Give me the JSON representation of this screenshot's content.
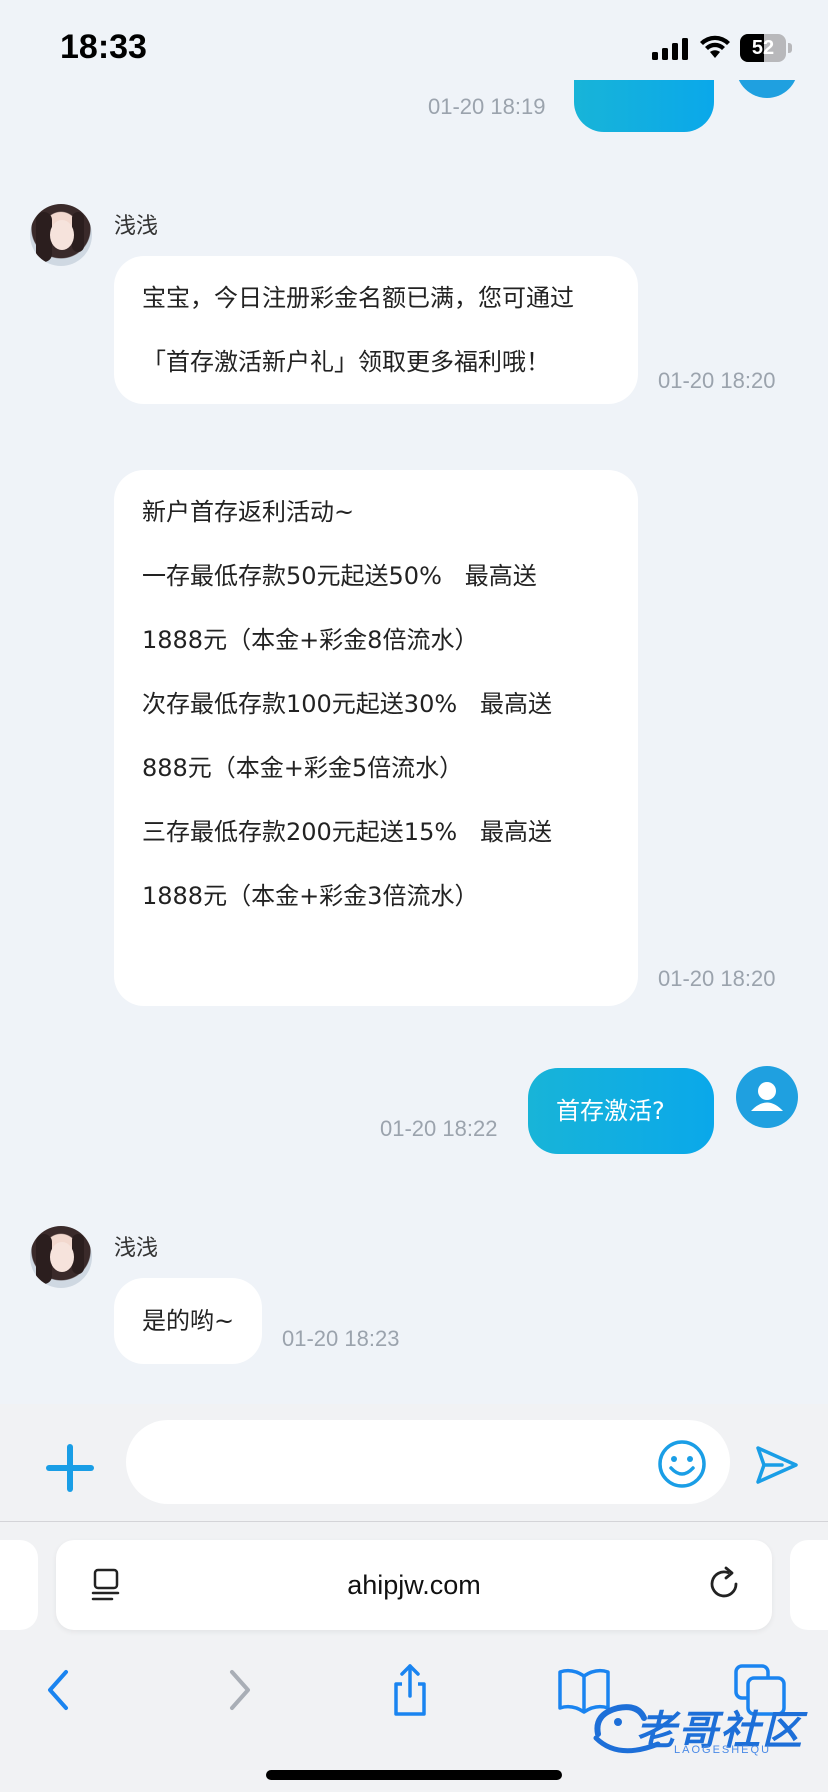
{
  "status_bar": {
    "time": "18:33",
    "battery_level": "52",
    "battery_fraction": 0.52
  },
  "chat": {
    "messages": [
      {
        "direction": "out",
        "partial": true,
        "time": "01-20 18:19"
      },
      {
        "direction": "in",
        "sender": "浅浅",
        "lines": [
          "宝宝，今日注册彩金名额已满，您可通过",
          "「首存激活新户礼」领取更多福利哦！"
        ],
        "time": "01-20 18:20"
      },
      {
        "direction": "in",
        "lines": [
          "新户首存返利活动~",
          "一存最低存款50元起送50%   最高送",
          "1888元（本金+彩金8倍流水）",
          "次存最低存款100元起送30%   最高送",
          "888元（本金+彩金5倍流水）",
          "三存最低存款200元起送15%   最高送",
          "1888元（本金+彩金3倍流水）"
        ],
        "time": "01-20 18:20"
      },
      {
        "direction": "out",
        "text": "首存激活?",
        "time": "01-20 18:22"
      },
      {
        "direction": "in",
        "sender": "浅浅",
        "text": "是的哟~",
        "time": "01-20 18:23"
      }
    ]
  },
  "input_bar": {
    "placeholder": "",
    "icons": [
      "plus-icon",
      "emoji-icon",
      "send-icon"
    ]
  },
  "browser": {
    "url": "ahipjw.com",
    "icons": [
      "page-menu-icon",
      "reload-icon"
    ]
  },
  "toolbar": {
    "icons": [
      "back-icon",
      "forward-icon",
      "share-icon",
      "bookmarks-icon",
      "tabs-icon"
    ]
  },
  "watermark": {
    "text": "老哥社区",
    "sub": "LAOGESHEQU"
  },
  "colors": {
    "background": "#eff3f8",
    "accent": "#1a9ee6",
    "outgoing_bubble": "#12aee0",
    "timestamp": "#9ba3ad"
  }
}
